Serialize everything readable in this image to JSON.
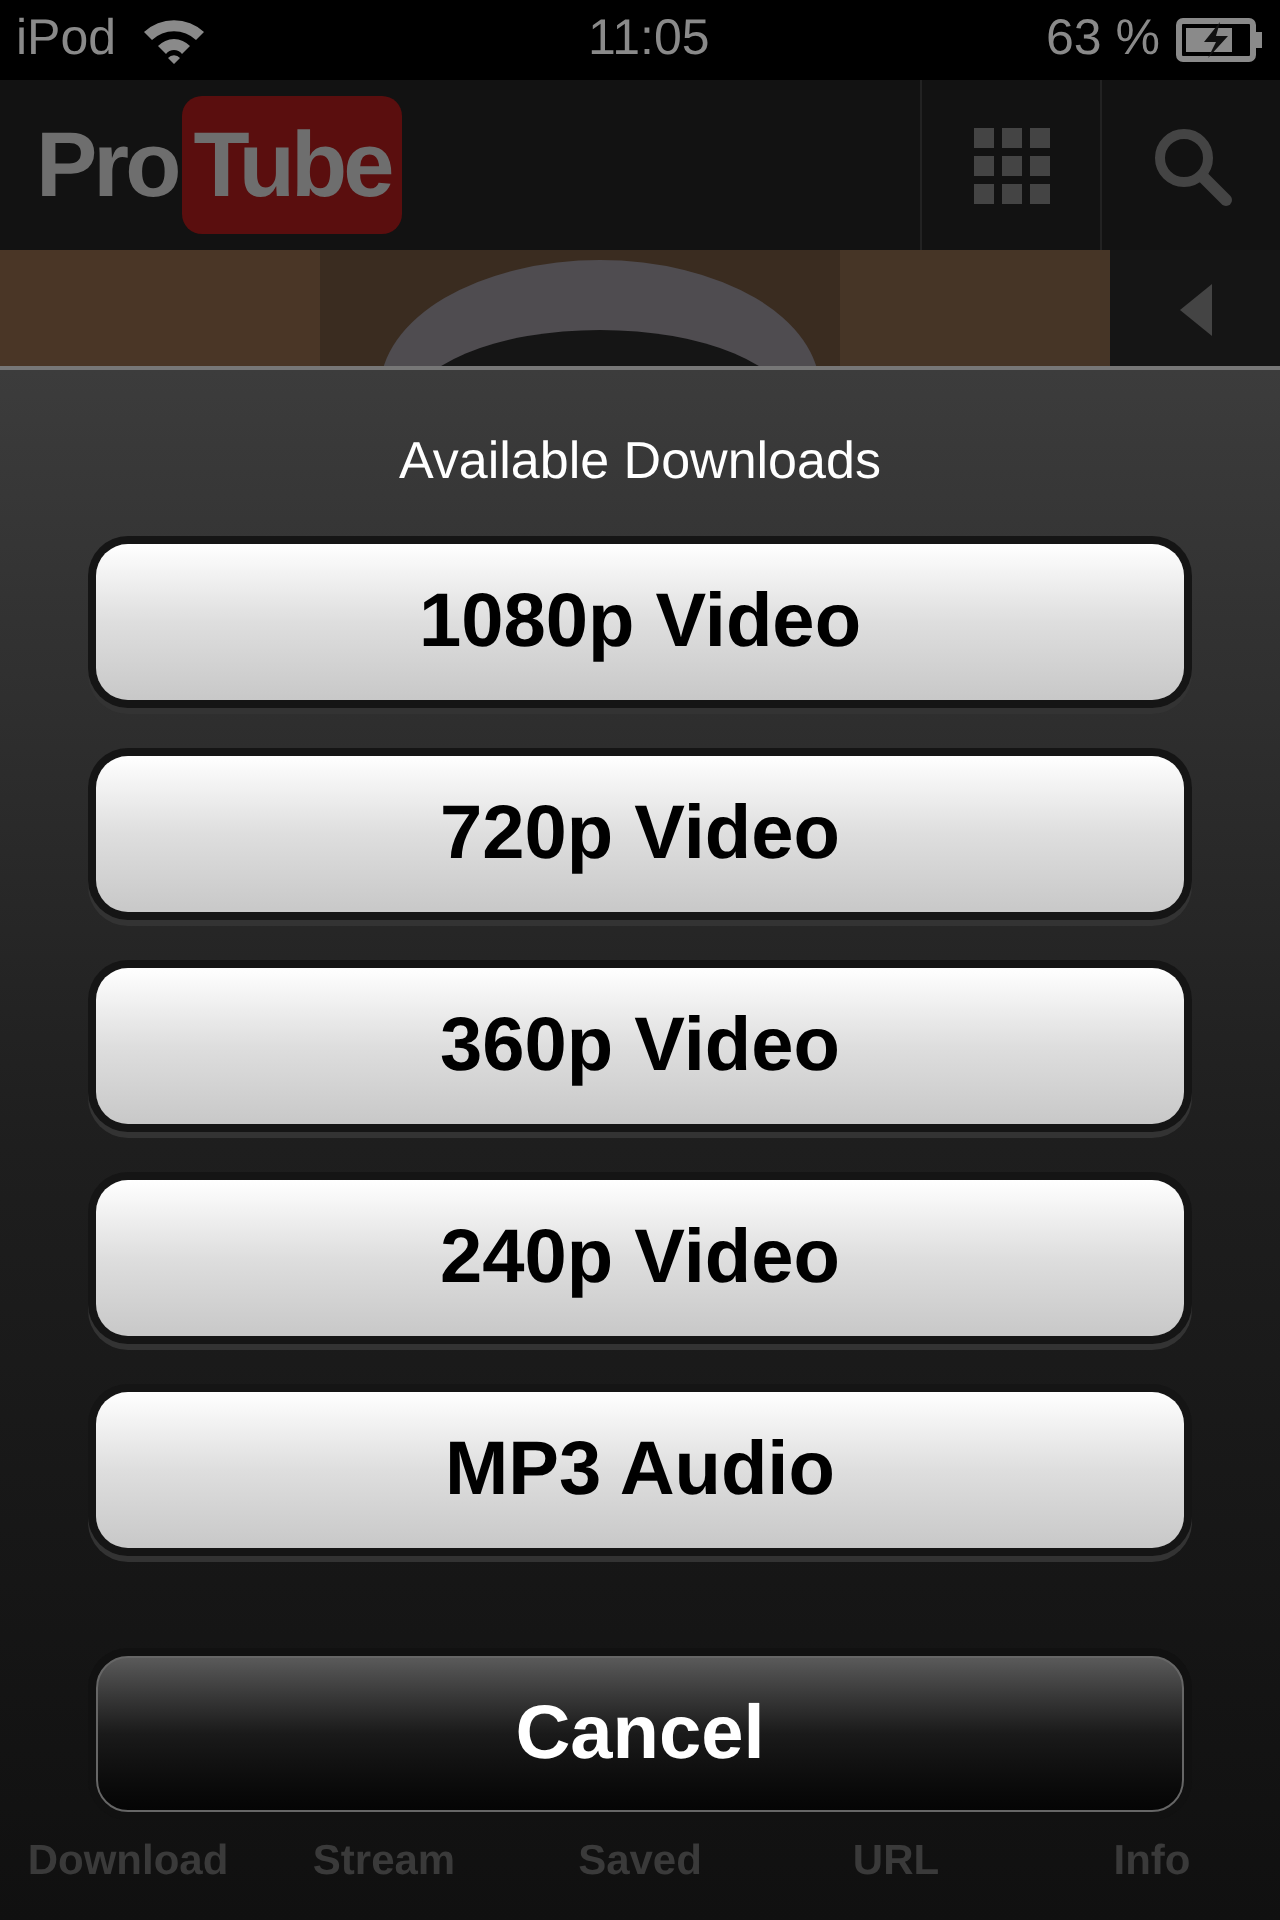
{
  "status_bar": {
    "carrier": "iPod",
    "time": "11:05",
    "battery": "63 %"
  },
  "header": {
    "logo_left": "Pro",
    "logo_right": "Tube"
  },
  "action_sheet": {
    "title": "Available Downloads",
    "options": [
      {
        "label": "1080p Video",
        "kind": "option"
      },
      {
        "label": "720p Video",
        "kind": "option"
      },
      {
        "label": "360p Video",
        "kind": "option"
      },
      {
        "label": "240p Video",
        "kind": "option"
      },
      {
        "label": "MP3 Audio",
        "kind": "option"
      },
      {
        "label": "Cancel",
        "kind": "cancel"
      }
    ]
  },
  "tab_bar": [
    "Download",
    "Stream",
    "Saved",
    "URL",
    "Info"
  ]
}
